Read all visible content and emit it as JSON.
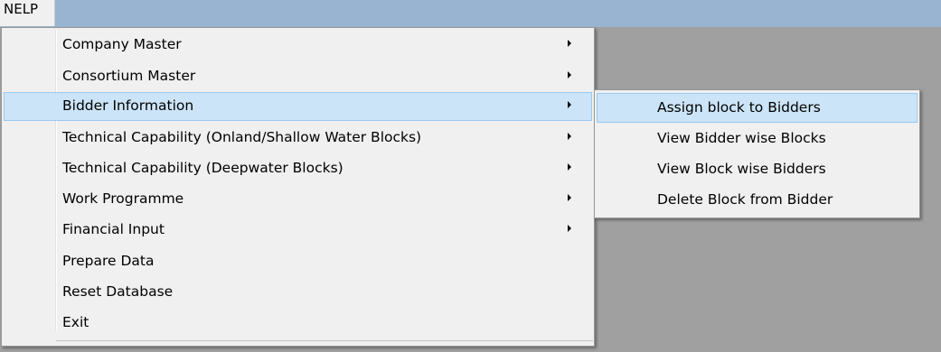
{
  "menubar": {
    "items": [
      {
        "label": "NELP"
      }
    ]
  },
  "main_menu": {
    "items": [
      {
        "label": "Company Master",
        "has_submenu": true
      },
      {
        "label": "Consortium Master",
        "has_submenu": true
      },
      {
        "label": "Bidder Information",
        "has_submenu": true,
        "highlighted": true
      },
      {
        "label": "Technical Capability (Onland/Shallow Water Blocks)",
        "has_submenu": true
      },
      {
        "label": "Technical Capability (Deepwater Blocks)",
        "has_submenu": true
      },
      {
        "label": "Work Programme",
        "has_submenu": true
      },
      {
        "label": "Financial Input",
        "has_submenu": true
      },
      {
        "label": "Prepare Data",
        "has_submenu": false
      },
      {
        "label": "Reset Database",
        "has_submenu": false
      },
      {
        "label": "Exit",
        "has_submenu": false
      }
    ]
  },
  "sub_menu": {
    "items": [
      {
        "label": "Assign block to Bidders",
        "highlighted": true
      },
      {
        "label": "View Bidder wise Blocks"
      },
      {
        "label": "View Block wise Bidders"
      },
      {
        "label": "Delete Block from Bidder"
      }
    ]
  },
  "colors": {
    "menubar_background": "#99b4d1",
    "workspace_background": "#a0a0a0",
    "menu_background": "#f0f0f0",
    "highlight": "#cce4f7",
    "highlight_border": "#99c9ef"
  }
}
